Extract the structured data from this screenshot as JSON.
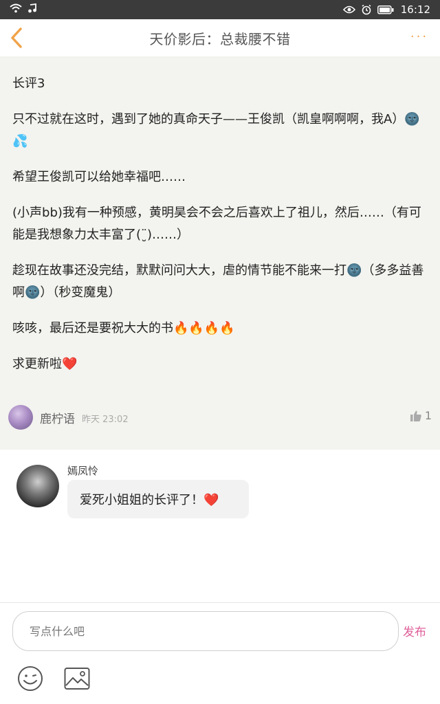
{
  "status_bar": {
    "time": "16:12",
    "icons": [
      "wifi-icon",
      "music-icon",
      "eye-icon",
      "alarm-icon",
      "battery-icon"
    ]
  },
  "header": {
    "title": "天价影后：总裁腰不错",
    "back_icon": "chevron-left-icon",
    "more_label": "···",
    "accent_color": "#f0a34a"
  },
  "post": {
    "paragraphs": [
      "长评3",
      "只不过就在这时，遇到了她的真命天子——王俊凯（凯皇啊啊啊，我A）🌚💦",
      "希望王俊凯可以给她幸福吧……",
      "(小声bb)我有一种预感，黄明昊会不会之后喜欢上了祖儿，然后……（有可能是我想象力太丰富了(¨̮)……）",
      "趁现在故事还没完结，默默问问大大，虐的情节能不能来一打🌚（多多益善啊🌚）（秒变魔鬼）",
      "咳咳，最后还是要祝大大的书🔥🔥🔥🔥",
      "求更新啦❤️"
    ],
    "author": "鹿柠语",
    "time": "昨天 23:02",
    "likes": "1"
  },
  "comment": {
    "name": "嫣凤怜",
    "text": "爱死小姐姐的长评了！❤️"
  },
  "input": {
    "placeholder": "写点什么吧",
    "publish_label": "发布",
    "publish_color": "#e0609a"
  }
}
